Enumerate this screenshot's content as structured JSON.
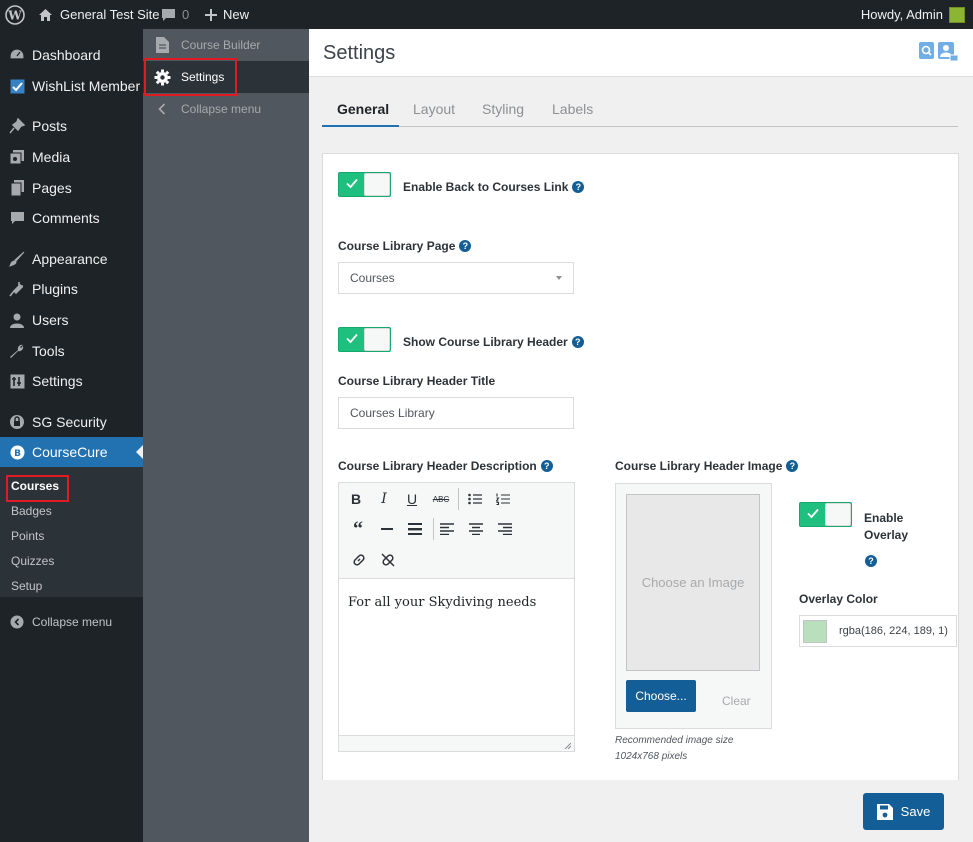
{
  "adminbar": {
    "site_name": "General Test Site",
    "comments_count": "0",
    "new_label": "New",
    "howdy": "Howdy, Admin"
  },
  "sidebar": {
    "items": [
      {
        "label": "Dashboard",
        "icon": "dashboard-icon"
      },
      {
        "label": "WishList Member",
        "icon": "wishlist-icon"
      },
      {
        "label": "Posts",
        "icon": "pin-icon"
      },
      {
        "label": "Media",
        "icon": "media-icon"
      },
      {
        "label": "Pages",
        "icon": "pages-icon"
      },
      {
        "label": "Comments",
        "icon": "comment-icon"
      },
      {
        "label": "Appearance",
        "icon": "brush-icon"
      },
      {
        "label": "Plugins",
        "icon": "plugin-icon"
      },
      {
        "label": "Users",
        "icon": "user-icon"
      },
      {
        "label": "Tools",
        "icon": "wrench-icon"
      },
      {
        "label": "Settings",
        "icon": "settings-icon"
      },
      {
        "label": "SG Security",
        "icon": "lock-icon"
      },
      {
        "label": "CourseCure",
        "icon": "coursecure-icon"
      }
    ],
    "submenu": [
      "Courses",
      "Badges",
      "Points",
      "Quizzes",
      "Setup"
    ],
    "collapse": "Collapse menu"
  },
  "sidebar2": {
    "items": [
      "Course Builder",
      "Settings"
    ],
    "collapse": "Collapse menu"
  },
  "page": {
    "title": "Settings",
    "tabs": [
      "General",
      "Layout",
      "Styling",
      "Labels"
    ]
  },
  "form": {
    "back_link_label": "Enable Back to Courses Link",
    "library_page_label": "Course Library Page",
    "library_page_value": "Courses",
    "show_header_label": "Show Course Library Header",
    "header_title_label": "Course Library Header Title",
    "header_title_value": "Courses Library",
    "header_desc_label": "Course Library Header Description",
    "header_desc_value": "For all your Skydiving needs",
    "header_image_label": "Course Library Header Image",
    "choose_image_placeholder": "Choose an Image",
    "choose_button": "Choose...",
    "clear_button": "Clear",
    "image_hint_line1": "Recommended image size",
    "image_hint_line2": "1024x768 pixels",
    "enable_overlay_line1": "Enable",
    "enable_overlay_line2": "Overlay",
    "overlay_color_label": "Overlay Color",
    "overlay_color_value": "rgba(186, 224, 189, 1)",
    "overlay_color_swatch": "#badfbd",
    "save_button": "Save"
  },
  "editor_toolbar": {
    "bold": "B",
    "italic": "I",
    "underline": "U",
    "strikethrough": "ABC"
  },
  "colors": {
    "accent": "#2271b1",
    "toggle_on": "#1fbf7f",
    "primary_button": "#135e96",
    "highlight": "#e01b24"
  }
}
